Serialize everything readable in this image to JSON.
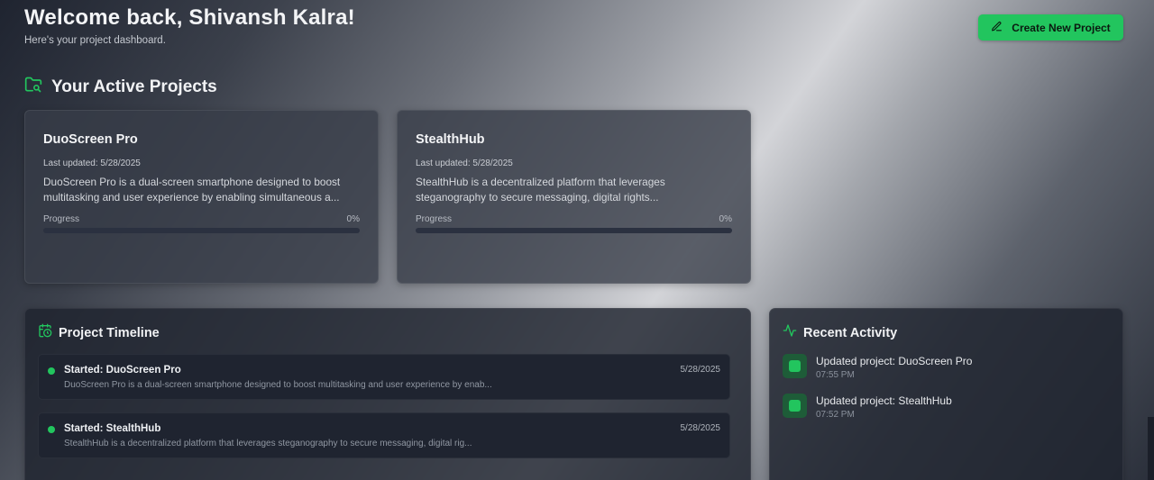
{
  "header": {
    "title": "Welcome back, Shivansh Kalra!",
    "subtitle": "Here's your project dashboard."
  },
  "create_button": {
    "label": "Create New Project",
    "icon": "pencil-icon"
  },
  "active_projects": {
    "title": "Your Active Projects",
    "icon": "folder-icon",
    "cards": [
      {
        "name": "DuoScreen Pro",
        "updated": "Last updated: 5/28/2025",
        "description": "DuoScreen Pro is a dual-screen smartphone designed to boost multitasking and user experience by enabling simultaneous a...",
        "progress_label": "Progress",
        "progress_text": "0%",
        "progress": 0
      },
      {
        "name": "StealthHub",
        "updated": "Last updated: 5/28/2025",
        "description": "StealthHub is a decentralized platform that leverages steganography to secure messaging, digital rights...",
        "progress_label": "Progress",
        "progress_text": "0%",
        "progress": 0
      }
    ]
  },
  "timeline": {
    "title": "Project Timeline",
    "icon": "calendar-icon",
    "items": [
      {
        "title": "Started: DuoScreen Pro",
        "date": "5/28/2025",
        "description": "DuoScreen Pro is a dual-screen smartphone designed to boost multitasking and user experience by enab..."
      },
      {
        "title": "Started: StealthHub",
        "date": "5/28/2025",
        "description": "StealthHub is a decentralized platform that leverages steganography to secure messaging, digital rig..."
      }
    ]
  },
  "activity": {
    "title": "Recent Activity",
    "icon": "activity-pulse-icon",
    "items": [
      {
        "title": "Updated project: DuoScreen Pro",
        "time": "07:55 PM"
      },
      {
        "title": "Updated project: StealthHub",
        "time": "07:52 PM"
      }
    ]
  },
  "colors": {
    "accent": "#22c55e",
    "card_bg": "#373c48",
    "panel_bg": "#1e232e"
  }
}
